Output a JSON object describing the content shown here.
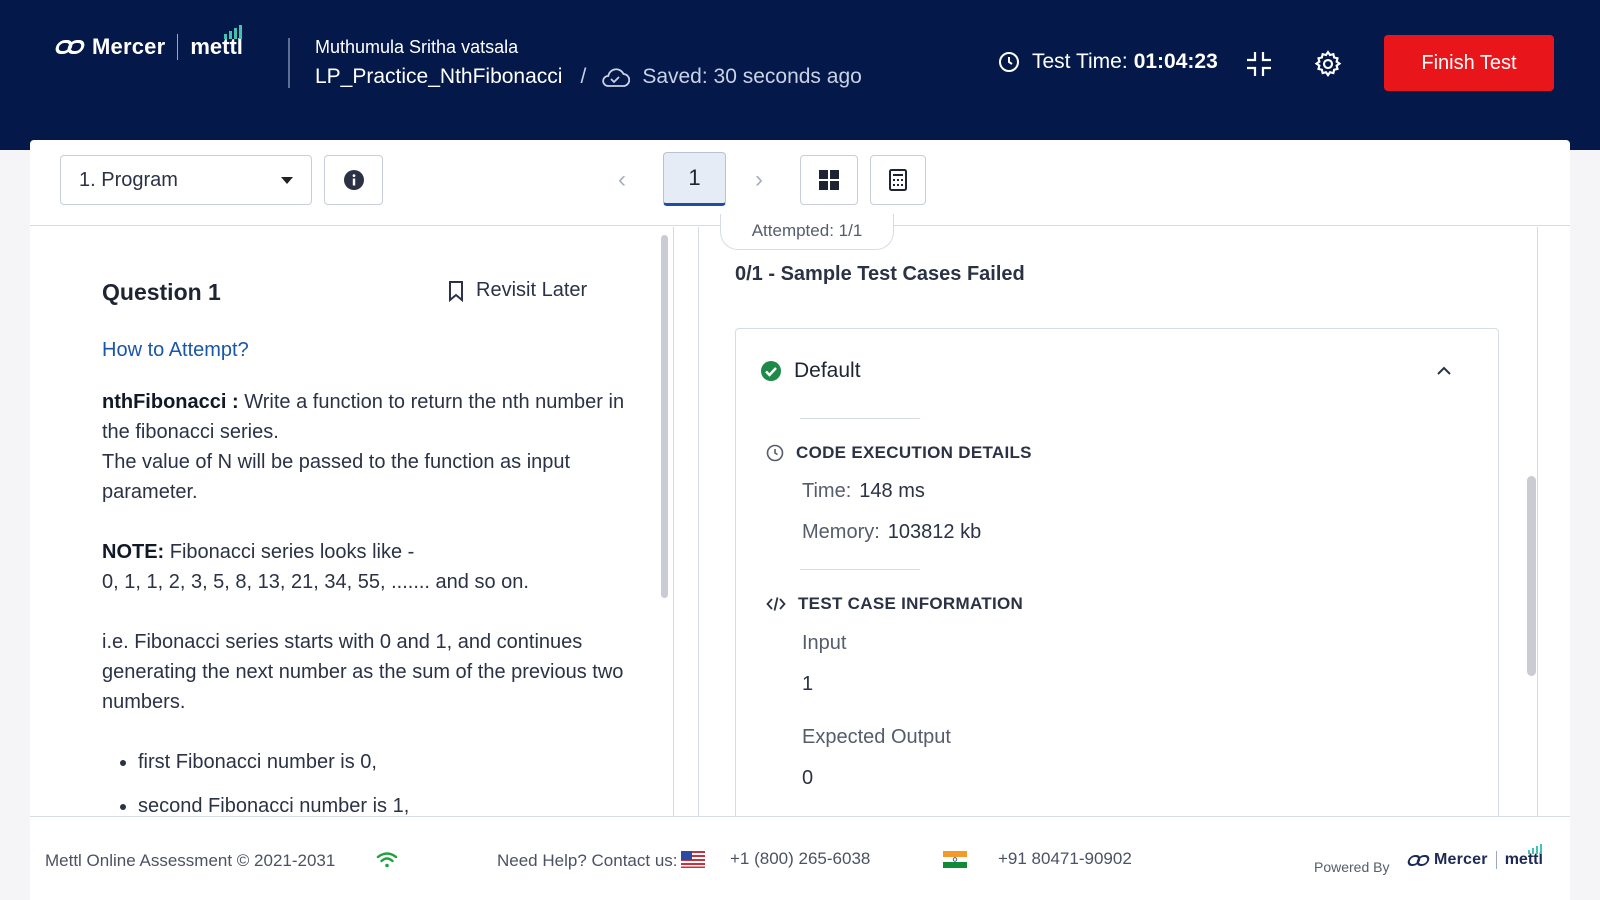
{
  "header": {
    "brand_name": "Mercer",
    "brand_partner": "mettl",
    "candidate_name": "Muthumula Sritha vatsala",
    "test_name": "LP_Practice_NthFibonacci",
    "separator": "/",
    "saved_status": "Saved: 30 seconds ago",
    "timer_label": "Test Time:",
    "timer_value": "01:04:23",
    "finish_button": "Finish Test",
    "colors": {
      "background": "#04194a",
      "finish": "#e8161b",
      "accent": "#42c3ad"
    }
  },
  "toolbar": {
    "section_select": "1. Program",
    "prev": "‹",
    "current_question": "1",
    "next": "›",
    "attempted": "Attempted: 1/1"
  },
  "question": {
    "title": "Question 1",
    "revisit_label": "Revisit Later",
    "how_to_attempt": "How to Attempt?",
    "fn_name": "nthFibonacci :",
    "fn_desc": " Write a function to return the nth number in the fibonacci series.",
    "input_desc": "The value of N will be passed to the function as input parameter.",
    "note_label": "NOTE:",
    "note_text": " Fibonacci series looks like -",
    "series": "0, 1, 1, 2, 3, 5, 8, 13, 21, 34, 55, ....... and so on.",
    "explanation": "i.e. Fibonacci series starts with 0 and 1, and continues generating the next number as the sum of the previous two numbers.",
    "bullets": [
      "first Fibonacci number is 0,",
      "second Fibonacci number is 1,"
    ]
  },
  "result": {
    "summary": "0/1 - Sample Test Cases Failed",
    "case_name": "Default",
    "exec_heading": "CODE EXECUTION DETAILS",
    "time_label": "Time:",
    "time_value": "148 ms",
    "memory_label": "Memory:",
    "memory_value": "103812 kb",
    "info_heading": "TEST CASE INFORMATION",
    "input_label": "Input",
    "input_value": "1",
    "expected_label": "Expected Output",
    "expected_value": "0"
  },
  "footer": {
    "copyright": "Mettl Online Assessment © 2021-2031",
    "help": "Need Help? Contact us:",
    "phone_us": "+1 (800) 265-6038",
    "phone_in": "+91 80471-90902",
    "powered_by": "Powered By",
    "brand_name": "Mercer",
    "brand_partner": "mettl"
  }
}
